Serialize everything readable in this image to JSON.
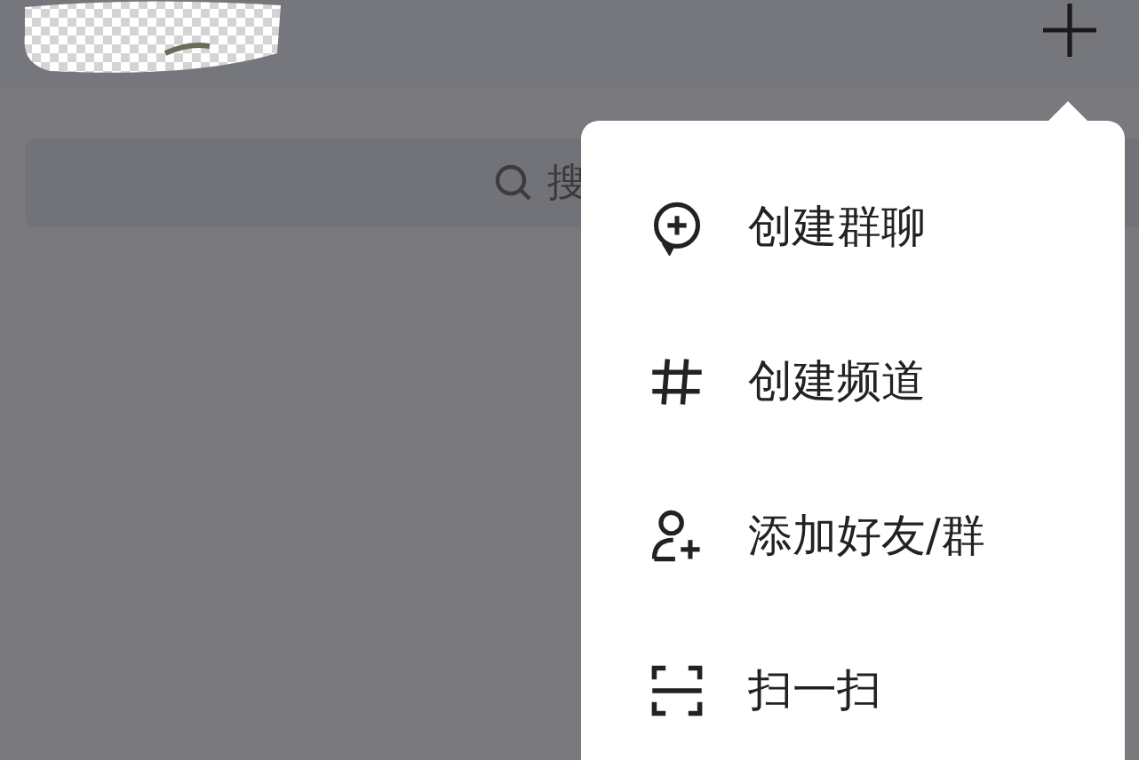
{
  "search": {
    "placeholder": "搜"
  },
  "menu": {
    "items": [
      {
        "kind": "group_chat",
        "label": "创建群聊"
      },
      {
        "kind": "channel",
        "label": "创建频道"
      },
      {
        "kind": "add_friend",
        "label": "添加好友/群"
      },
      {
        "kind": "scan",
        "label": "扫一扫"
      }
    ]
  }
}
